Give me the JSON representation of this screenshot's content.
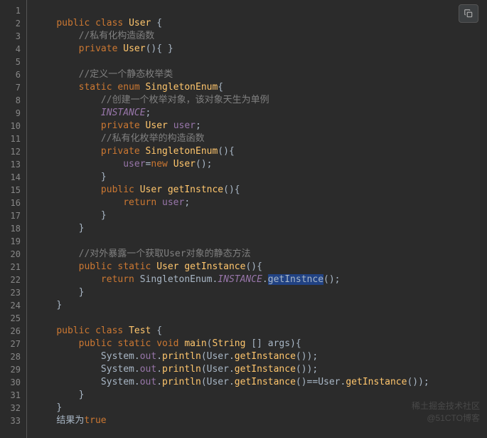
{
  "line_count": 33,
  "code": {
    "l1": {
      "tokens": []
    },
    "l2": {
      "indent": "    ",
      "tokens": [
        {
          "t": "public ",
          "c": "kw"
        },
        {
          "t": "class ",
          "c": "kw"
        },
        {
          "t": "User ",
          "c": "cls"
        },
        {
          "t": "{",
          "c": "punc"
        }
      ]
    },
    "l3": {
      "indent": "        ",
      "tokens": [
        {
          "t": "//私有化构造函数",
          "c": "comment"
        }
      ]
    },
    "l4": {
      "indent": "        ",
      "tokens": [
        {
          "t": "private ",
          "c": "kw"
        },
        {
          "t": "User",
          "c": "cls"
        },
        {
          "t": "(){ }",
          "c": "punc"
        }
      ]
    },
    "l5": {
      "tokens": []
    },
    "l6": {
      "indent": "        ",
      "tokens": [
        {
          "t": "//定义一个静态枚举类",
          "c": "comment"
        }
      ]
    },
    "l7": {
      "indent": "        ",
      "tokens": [
        {
          "t": "static enum ",
          "c": "kw"
        },
        {
          "t": "SingletonEnum",
          "c": "cls"
        },
        {
          "t": "{",
          "c": "punc"
        }
      ]
    },
    "l8": {
      "indent": "            ",
      "tokens": [
        {
          "t": "//创建一个枚举对象，该对象天生为单例",
          "c": "comment"
        }
      ]
    },
    "l9": {
      "indent": "            ",
      "tokens": [
        {
          "t": "INSTANCE",
          "c": "const"
        },
        {
          "t": ";",
          "c": "punc"
        }
      ]
    },
    "l10": {
      "indent": "            ",
      "tokens": [
        {
          "t": "private ",
          "c": "kw"
        },
        {
          "t": "User ",
          "c": "cls"
        },
        {
          "t": "user",
          "c": "field"
        },
        {
          "t": ";",
          "c": "punc"
        }
      ]
    },
    "l11": {
      "indent": "            ",
      "tokens": [
        {
          "t": "//私有化枚举的构造函数",
          "c": "comment"
        }
      ]
    },
    "l12": {
      "indent": "            ",
      "tokens": [
        {
          "t": "private ",
          "c": "kw"
        },
        {
          "t": "SingletonEnum",
          "c": "cls"
        },
        {
          "t": "(){",
          "c": "punc"
        }
      ]
    },
    "l13": {
      "indent": "                ",
      "tokens": [
        {
          "t": "user",
          "c": "field"
        },
        {
          "t": "=",
          "c": "punc"
        },
        {
          "t": "new ",
          "c": "kw"
        },
        {
          "t": "User",
          "c": "cls"
        },
        {
          "t": "();",
          "c": "punc"
        }
      ]
    },
    "l14": {
      "indent": "            ",
      "tokens": [
        {
          "t": "}",
          "c": "punc"
        }
      ]
    },
    "l15": {
      "indent": "            ",
      "tokens": [
        {
          "t": "public ",
          "c": "kw"
        },
        {
          "t": "User ",
          "c": "cls"
        },
        {
          "t": "getInstnce",
          "c": "method"
        },
        {
          "t": "(){",
          "c": "punc"
        }
      ]
    },
    "l16": {
      "indent": "                ",
      "tokens": [
        {
          "t": "return ",
          "c": "kw"
        },
        {
          "t": "user",
          "c": "field"
        },
        {
          "t": ";",
          "c": "punc"
        }
      ]
    },
    "l17": {
      "indent": "            ",
      "tokens": [
        {
          "t": "}",
          "c": "punc"
        }
      ]
    },
    "l18": {
      "indent": "        ",
      "tokens": [
        {
          "t": "}",
          "c": "punc"
        }
      ]
    },
    "l19": {
      "tokens": []
    },
    "l20": {
      "indent": "        ",
      "tokens": [
        {
          "t": "//对外暴露一个获取User对象的静态方法",
          "c": "comment"
        }
      ]
    },
    "l21": {
      "indent": "        ",
      "tokens": [
        {
          "t": "public static ",
          "c": "kw"
        },
        {
          "t": "User ",
          "c": "cls"
        },
        {
          "t": "getInstance",
          "c": "method"
        },
        {
          "t": "(){",
          "c": "punc"
        }
      ]
    },
    "l22": {
      "indent": "            ",
      "tokens": [
        {
          "t": "return ",
          "c": "kw"
        },
        {
          "t": "SingletonEnum.",
          "c": "type"
        },
        {
          "t": "INSTANCE",
          "c": "const"
        },
        {
          "t": ".",
          "c": "punc"
        },
        {
          "t": "getInstnce",
          "c": "highlight"
        },
        {
          "t": "();",
          "c": "punc"
        }
      ]
    },
    "l23": {
      "indent": "        ",
      "tokens": [
        {
          "t": "}",
          "c": "punc"
        }
      ]
    },
    "l24": {
      "indent": "    ",
      "tokens": [
        {
          "t": "}",
          "c": "punc"
        }
      ]
    },
    "l25": {
      "tokens": []
    },
    "l26": {
      "indent": "    ",
      "tokens": [
        {
          "t": "public ",
          "c": "kw"
        },
        {
          "t": "class ",
          "c": "kw"
        },
        {
          "t": "Test ",
          "c": "cls"
        },
        {
          "t": "{",
          "c": "punc"
        }
      ]
    },
    "l27": {
      "indent": "        ",
      "tokens": [
        {
          "t": "public static void ",
          "c": "kw"
        },
        {
          "t": "main",
          "c": "method"
        },
        {
          "t": "(",
          "c": "punc"
        },
        {
          "t": "String ",
          "c": "cls"
        },
        {
          "t": "[] args){",
          "c": "punc"
        }
      ]
    },
    "l28": {
      "indent": "            ",
      "tokens": [
        {
          "t": "System.",
          "c": "type"
        },
        {
          "t": "out",
          "c": "field"
        },
        {
          "t": ".",
          "c": "punc"
        },
        {
          "t": "println",
          "c": "method"
        },
        {
          "t": "(User.",
          "c": "punc"
        },
        {
          "t": "getInstance",
          "c": "method"
        },
        {
          "t": "());",
          "c": "punc"
        }
      ]
    },
    "l29": {
      "indent": "            ",
      "tokens": [
        {
          "t": "System.",
          "c": "type"
        },
        {
          "t": "out",
          "c": "field"
        },
        {
          "t": ".",
          "c": "punc"
        },
        {
          "t": "println",
          "c": "method"
        },
        {
          "t": "(User.",
          "c": "punc"
        },
        {
          "t": "getInstance",
          "c": "method"
        },
        {
          "t": "());",
          "c": "punc"
        }
      ]
    },
    "l30": {
      "indent": "            ",
      "tokens": [
        {
          "t": "System.",
          "c": "type"
        },
        {
          "t": "out",
          "c": "field"
        },
        {
          "t": ".",
          "c": "punc"
        },
        {
          "t": "println",
          "c": "method"
        },
        {
          "t": "(User.",
          "c": "punc"
        },
        {
          "t": "getInstance",
          "c": "method"
        },
        {
          "t": "()==User.",
          "c": "punc"
        },
        {
          "t": "getInstance",
          "c": "method"
        },
        {
          "t": "());",
          "c": "punc"
        }
      ]
    },
    "l31": {
      "indent": "        ",
      "tokens": [
        {
          "t": "}",
          "c": "punc"
        }
      ]
    },
    "l32": {
      "indent": "    ",
      "tokens": [
        {
          "t": "}",
          "c": "punc"
        }
      ]
    },
    "l33": {
      "indent": "    ",
      "tokens": [
        {
          "t": "结果为",
          "c": "type"
        },
        {
          "t": "true",
          "c": "kw"
        }
      ]
    }
  },
  "watermark": {
    "line1": "稀土掘金技术社区",
    "line2": "@51CTO博客"
  }
}
